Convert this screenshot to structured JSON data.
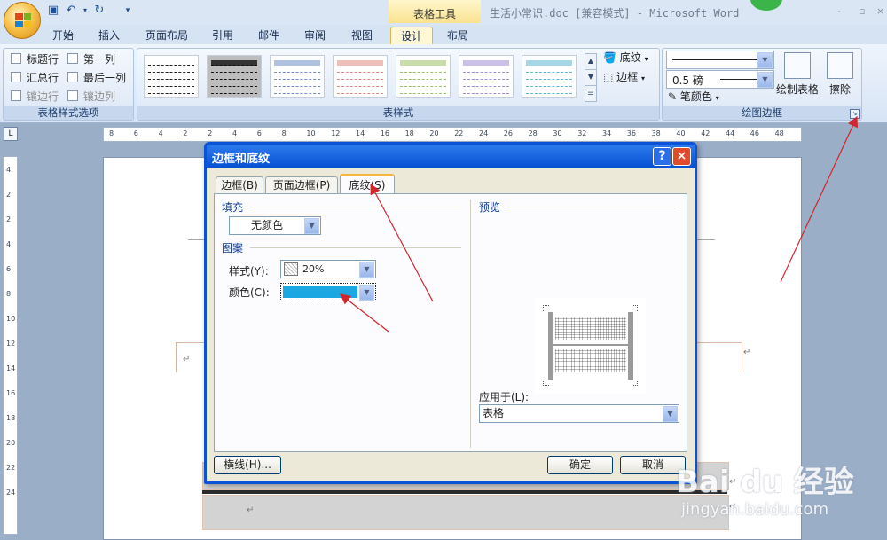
{
  "window": {
    "title": "生活小常识.doc [兼容模式] - Microsoft Word",
    "context_tool": "表格工具",
    "controls": [
      "-",
      "▫",
      "×"
    ]
  },
  "ribbon_tabs": [
    "开始",
    "插入",
    "页面布局",
    "引用",
    "邮件",
    "审阅",
    "视图",
    "设计",
    "布局"
  ],
  "ribbon": {
    "options_group": {
      "label": "表格样式选项",
      "items": [
        "标题行",
        "第一列",
        "汇总行",
        "最后一列",
        "镶边行",
        "镶边列"
      ]
    },
    "styles_group": {
      "label": "表样式",
      "thumb_colors": [
        "#222222",
        "#111111",
        "#6f8fc7",
        "#e28a84",
        "#9cc06a",
        "#a28ed0",
        "#5fb8d1"
      ],
      "shading_label": "底纹",
      "borders_label": "边框"
    },
    "draw_group": {
      "label": "绘图边框",
      "line_weight": "0.5 磅",
      "pen_color_label": "笔颜色",
      "draw_table_label": "绘制表格",
      "eraser_label": "擦除"
    }
  },
  "ruler": {
    "ticks": [
      "8",
      "6",
      "4",
      "2",
      "2",
      "4",
      "6",
      "8",
      "10",
      "12",
      "14",
      "16",
      "18",
      "20",
      "22",
      "24",
      "26",
      "28",
      "30",
      "32",
      "34",
      "36",
      "38",
      "40",
      "42",
      "44",
      "46",
      "48"
    ],
    "vticks": [
      "4",
      "2",
      "2",
      "4",
      "6",
      "8",
      "10",
      "12",
      "14",
      "16",
      "18",
      "20",
      "22",
      "24"
    ]
  },
  "dialog": {
    "title": "边框和底纹",
    "tabs": [
      "边框(B)",
      "页面边框(P)",
      "底纹(S)"
    ],
    "fill_label": "填充",
    "fill_value": "无颜色",
    "pattern_label": "图案",
    "style_label": "样式(Y):",
    "style_value": "20%",
    "color_label": "颜色(C):",
    "color_value": "#1aa7e2",
    "preview_label": "预览",
    "apply_label": "应用于(L):",
    "apply_value": "表格",
    "hline_button": "横线(H)...",
    "ok_button": "确定",
    "cancel_button": "取消"
  },
  "document": {
    "para_mark": "↵"
  },
  "watermark": {
    "main": "Bai du 经验",
    "sub": "jingyan.baidu.com"
  }
}
